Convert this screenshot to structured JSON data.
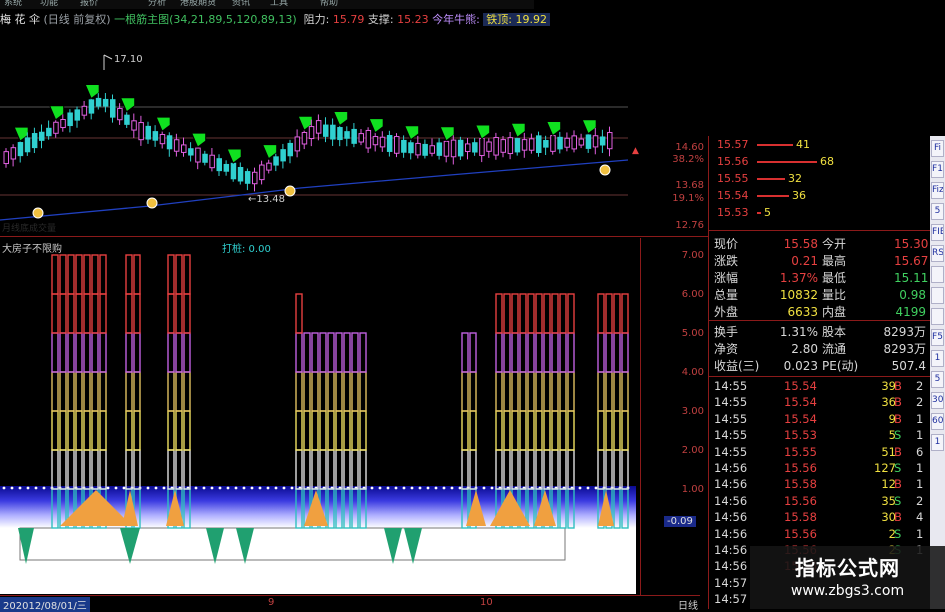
{
  "menubar": {
    "items": [
      "系统",
      "功能",
      "报价",
      "分析",
      "港股期货",
      "资讯",
      "工具",
      "帮助"
    ]
  },
  "header": {
    "stock": "梅 花 伞",
    "period": "(日线 前复权)",
    "indicator": "一根筋主图(34,21,89,5,120,89,13)",
    "resistance_label": "阻力:",
    "resistance_value": "15.79",
    "support_label": "支撑:",
    "support_value": "15.23",
    "bull_label": "今年牛熊:",
    "top_label": "铁顶:",
    "top_value": "19.92"
  },
  "upper_chart": {
    "high_label": "17.10",
    "low_label": "←13.48",
    "faded_label": "月线底成交量",
    "y_axis": [
      {
        "value": "14.60",
        "color": "#c04040"
      },
      {
        "value": "38.2%",
        "color": "#c04040"
      },
      {
        "value": "13.68",
        "color": "#c04040"
      },
      {
        "value": "19.1%",
        "color": "#c04040"
      },
      {
        "value": "12.76",
        "color": "#c04040"
      }
    ]
  },
  "lower_chart": {
    "title": "大房子不限购",
    "subtitle": "打桩: 0.00",
    "y_axis": [
      "7.00",
      "6.00",
      "5.00",
      "4.00",
      "3.00",
      "2.00",
      "1.00"
    ],
    "current_value": "-0.09"
  },
  "timeline": {
    "prefix": "20",
    "date": "2012/08/01/三",
    "month9": "9",
    "month10": "10",
    "period_label": "日线"
  },
  "orderbook": [
    {
      "price": "15.57",
      "volume": "41",
      "bar": 0.45
    },
    {
      "price": "15.56",
      "volume": "68",
      "bar": 0.75
    },
    {
      "price": "15.55",
      "volume": "32",
      "bar": 0.35
    },
    {
      "price": "15.54",
      "volume": "36",
      "bar": 0.4
    },
    {
      "price": "15.53",
      "volume": "5",
      "bar": 0.05
    }
  ],
  "stats": [
    {
      "l1": "现价",
      "v1": "15.58",
      "l2": "今开",
      "v2": "15.30"
    },
    {
      "l1": "涨跌",
      "v1": "0.21",
      "l2": "最高",
      "v2": "15.67"
    },
    {
      "l1": "涨幅",
      "v1": "1.37%",
      "l2": "最低",
      "v2": "15.11"
    },
    {
      "l1": "总量",
      "v1": "10832",
      "l2": "量比",
      "v2": "0.98"
    },
    {
      "l1": "外盘",
      "v1": "6633",
      "l2": "内盘",
      "v2": "4199"
    }
  ],
  "stats2": [
    {
      "l1": "换手",
      "v1": "1.31%",
      "l2": "股本",
      "v2": "8293万"
    },
    {
      "l1": "净资",
      "v1": "2.80",
      "l2": "流通",
      "v2": "8293万"
    },
    {
      "l1": "收益(三)",
      "v1": "0.023",
      "l2": "PE(动)",
      "v2": "507.4"
    }
  ],
  "trades": [
    {
      "time": "14:55",
      "price": "15.54",
      "vol": "39",
      "bs": "B",
      "r": "2"
    },
    {
      "time": "14:55",
      "price": "15.54",
      "vol": "36",
      "bs": "B",
      "r": "2"
    },
    {
      "time": "14:55",
      "price": "15.54",
      "vol": "9",
      "bs": "B",
      "r": "1"
    },
    {
      "time": "14:55",
      "price": "15.53",
      "vol": "5",
      "bs": "S",
      "r": "1"
    },
    {
      "time": "14:55",
      "price": "15.55",
      "vol": "51",
      "bs": "B",
      "r": "6"
    },
    {
      "time": "14:56",
      "price": "15.56",
      "vol": "127",
      "bs": "S",
      "r": "1"
    },
    {
      "time": "14:56",
      "price": "15.58",
      "vol": "12",
      "bs": "B",
      "r": "1"
    },
    {
      "time": "14:56",
      "price": "15.56",
      "vol": "35",
      "bs": "S",
      "r": "2"
    },
    {
      "time": "14:56",
      "price": "15.58",
      "vol": "30",
      "bs": "B",
      "r": "4"
    },
    {
      "time": "14:56",
      "price": "15.56",
      "vol": "2",
      "bs": "S",
      "r": "1"
    },
    {
      "time": "14:56",
      "price": "15.56",
      "vol": "2",
      "bs": "S",
      "r": "1"
    },
    {
      "time": "14:56",
      "price": "15.56",
      "vol": "",
      "bs": "",
      "r": ""
    },
    {
      "time": "14:57",
      "price": "",
      "vol": "",
      "bs": "",
      "r": ""
    },
    {
      "time": "14:57",
      "price": "",
      "vol": "",
      "bs": "",
      "r": ""
    }
  ],
  "sidebar": [
    "Fi",
    "F1",
    "Fiz",
    "5",
    "FIB",
    "RSI",
    "",
    "",
    "",
    "F5",
    "1",
    "5",
    "30",
    "60",
    "1"
  ],
  "watermark": {
    "line1": "指标公式网",
    "line2": "www.zbgs3.com"
  },
  "colors": {
    "up": "#e64040",
    "down": "#40d060",
    "yellow": "#f0e040",
    "cyan": "#30d0d0",
    "blue_line": "#2040c0"
  }
}
